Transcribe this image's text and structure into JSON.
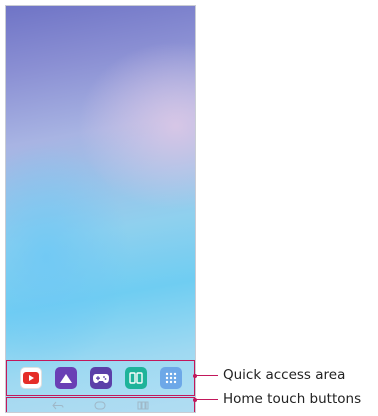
{
  "callouts": {
    "quick_access": "Quick access area",
    "home_touch": "Home touch buttons"
  },
  "quick_access_apps": [
    {
      "name": "youtube-icon",
      "color": "#e52d27"
    },
    {
      "name": "gallery-icon",
      "color": "#6a3fb5"
    },
    {
      "name": "game-icon",
      "color": "#5b3fa8"
    },
    {
      "name": "multi-window-icon",
      "color": "#1fb39a"
    },
    {
      "name": "apps-drawer-icon",
      "color": "#6da8e8"
    }
  ],
  "home_touch_buttons": [
    {
      "name": "back-button-icon"
    },
    {
      "name": "home-button-icon"
    },
    {
      "name": "recents-button-icon"
    }
  ],
  "colors": {
    "callout_accent": "#c2185b"
  }
}
